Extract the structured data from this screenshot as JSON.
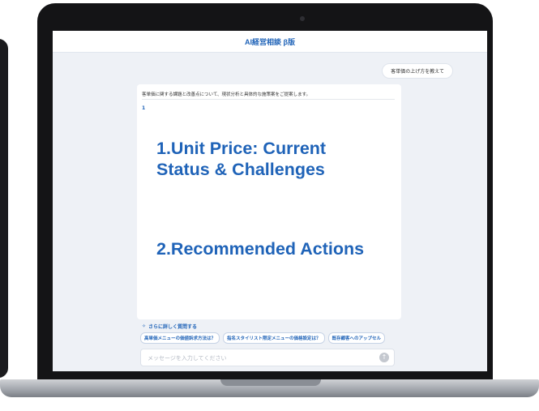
{
  "app": {
    "title": "AI経営相談 β版"
  },
  "conversation": {
    "user_message": "客単価の上げ方を教えて",
    "response_intro": "客単価に関する課題と改善点について、現状分析と具体的な施策案をご提案します。"
  },
  "overlay": {
    "heading_1": "1.Unit Price: Current Status & Challenges",
    "heading_2": "2.Recommended Actions"
  },
  "suggestions": {
    "label": "さらに詳しく質問する",
    "chips": [
      "高単価メニューの価値訴求方法は？",
      "指名スタイリスト限定メニューの価格設定は？",
      "既存顧客へのアップセル"
    ]
  },
  "composer": {
    "placeholder": "メッセージを入力してください"
  },
  "icons": {
    "suggest": "sparkle-icon",
    "send": "send-arrow-icon"
  },
  "colors": {
    "accent": "#1f63b8",
    "screen_bg": "#eef1f6"
  }
}
